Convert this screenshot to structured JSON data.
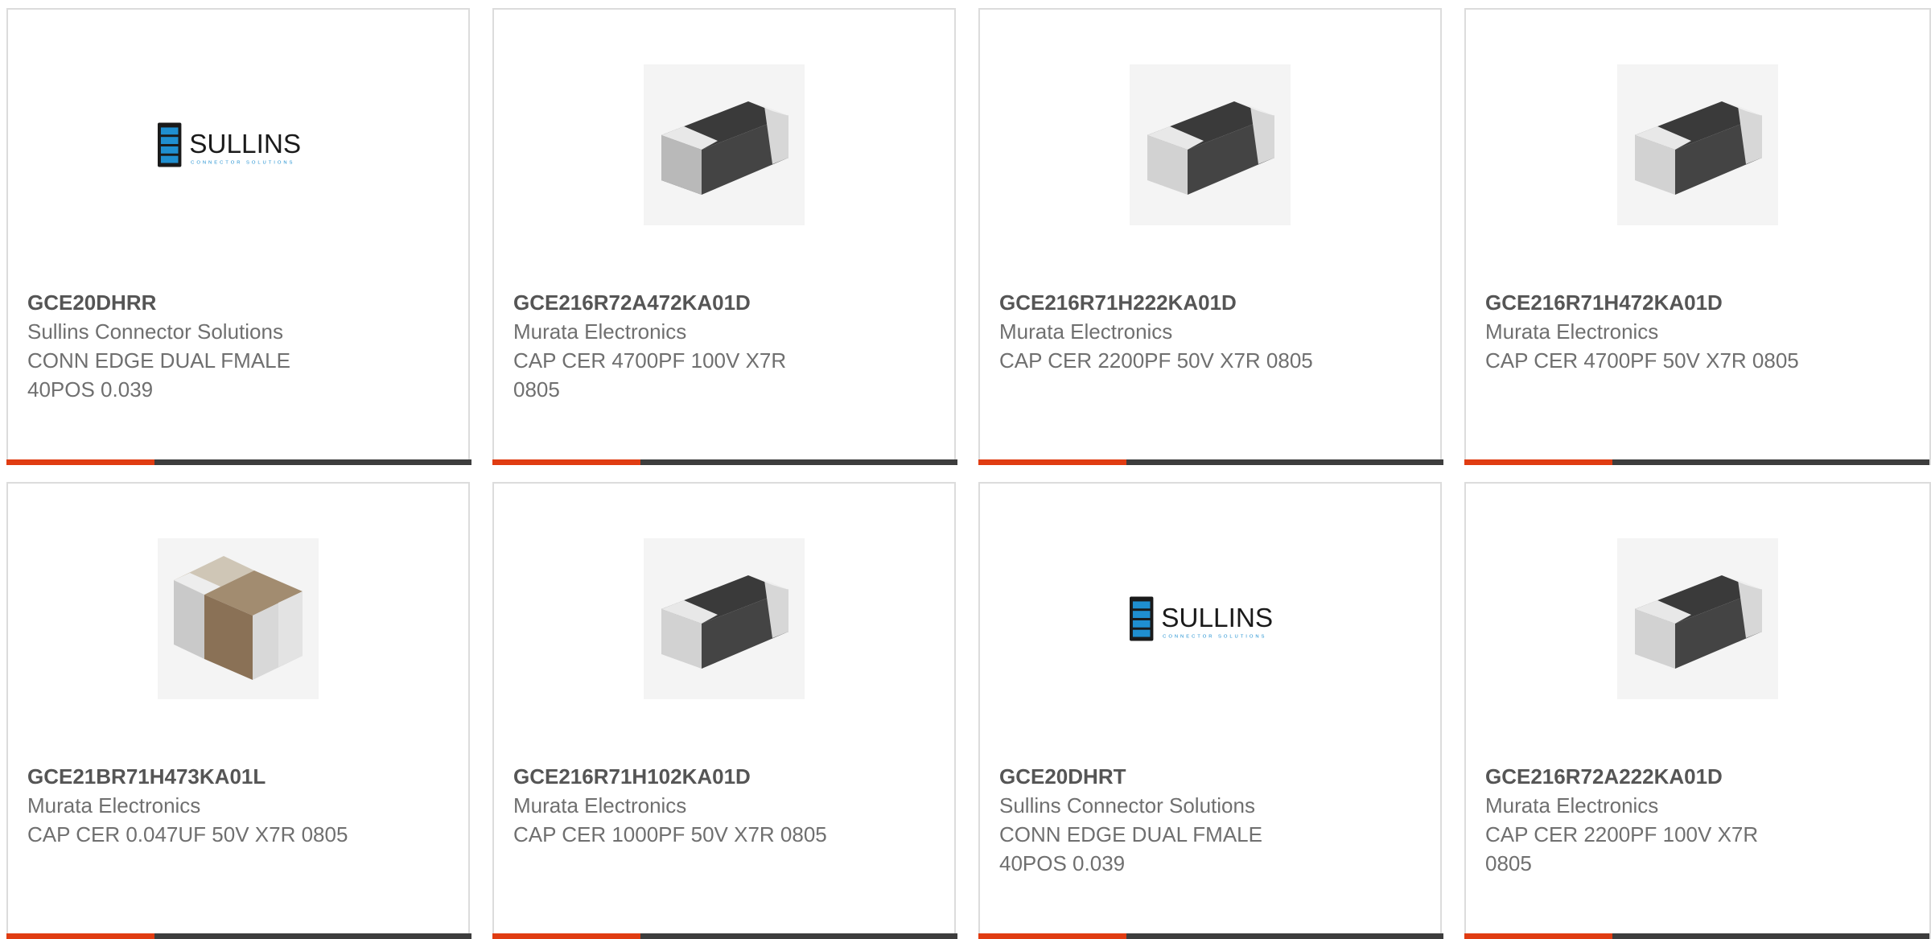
{
  "products": [
    {
      "part_number": "GCE20DHRR",
      "manufacturer": "Sullins Connector Solutions",
      "description": "CONN EDGE DUAL FMALE 40POS 0.039",
      "image": "sullins-logo"
    },
    {
      "part_number": "GCE216R72A472KA01D",
      "manufacturer": "Murata Electronics",
      "description": "CAP CER 4700PF 100V X7R 0805",
      "image": "mlcc-capacitor-dark"
    },
    {
      "part_number": "GCE216R71H222KA01D",
      "manufacturer": "Murata Electronics",
      "description": "CAP CER 2200PF 50V X7R 0805",
      "image": "mlcc-capacitor-dark"
    },
    {
      "part_number": "GCE216R71H472KA01D",
      "manufacturer": "Murata Electronics",
      "description": "CAP CER 4700PF 50V X7R 0805",
      "image": "mlcc-capacitor-dark"
    },
    {
      "part_number": "GCE21BR71H473KA01L",
      "manufacturer": "Murata Electronics",
      "description": "CAP CER 0.047UF 50V X7R 0805",
      "image": "mlcc-capacitor-brown"
    },
    {
      "part_number": "GCE216R71H102KA01D",
      "manufacturer": "Murata Electronics",
      "description": "CAP CER 1000PF 50V X7R 0805",
      "image": "mlcc-capacitor-dark"
    },
    {
      "part_number": "GCE20DHRT",
      "manufacturer": "Sullins Connector Solutions",
      "description": "CONN EDGE DUAL FMALE 40POS 0.039",
      "image": "sullins-logo"
    },
    {
      "part_number": "GCE216R72A222KA01D",
      "manufacturer": "Murata Electronics",
      "description": "CAP CER 2200PF 100V X7R 0805",
      "image": "mlcc-capacitor-dark"
    }
  ],
  "logo": {
    "brand": "SULLINS",
    "tagline": "CONNECTOR SOLUTIONS"
  },
  "colors": {
    "accent": "#e03c12",
    "bar": "#3d3d3d",
    "border": "#dcdcdc",
    "text": "#6f6f6f"
  }
}
